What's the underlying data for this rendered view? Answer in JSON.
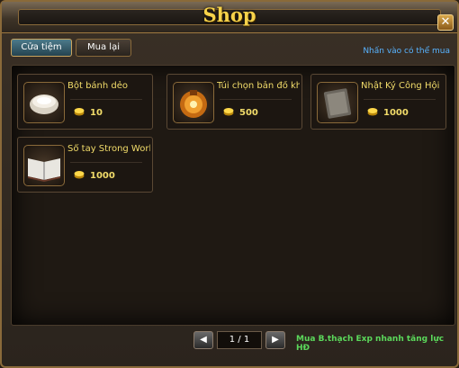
{
  "window": {
    "title": "Shop",
    "close_label": "✕"
  },
  "tabs": [
    {
      "label": "Cửa tiệm",
      "active": true
    },
    {
      "label": "Mua lại",
      "active": false
    }
  ],
  "hint_text": "Nhấn vào có thể mua",
  "items": [
    {
      "name": "Bột bánh dẻo",
      "price": "10",
      "icon": "flour-bowl-icon"
    },
    {
      "name": "Túi chọn bản đồ kho báu",
      "price": "500",
      "icon": "treasure-bag-icon"
    },
    {
      "name": "Nhật Ký Công Hội",
      "price": "1000",
      "icon": "guild-diary-icon"
    },
    {
      "name": "Sổ tay Strong World",
      "price": "1000",
      "icon": "open-book-icon"
    }
  ],
  "pager": {
    "prev_label": "◀",
    "page": "1 / 1",
    "next_label": "▶"
  },
  "promo_text": "Mua B.thạch Exp nhanh tăng lực HĐ",
  "colors": {
    "gold": "#f2dc6a",
    "hint": "#58b3ff",
    "promo": "#5bd95b"
  }
}
